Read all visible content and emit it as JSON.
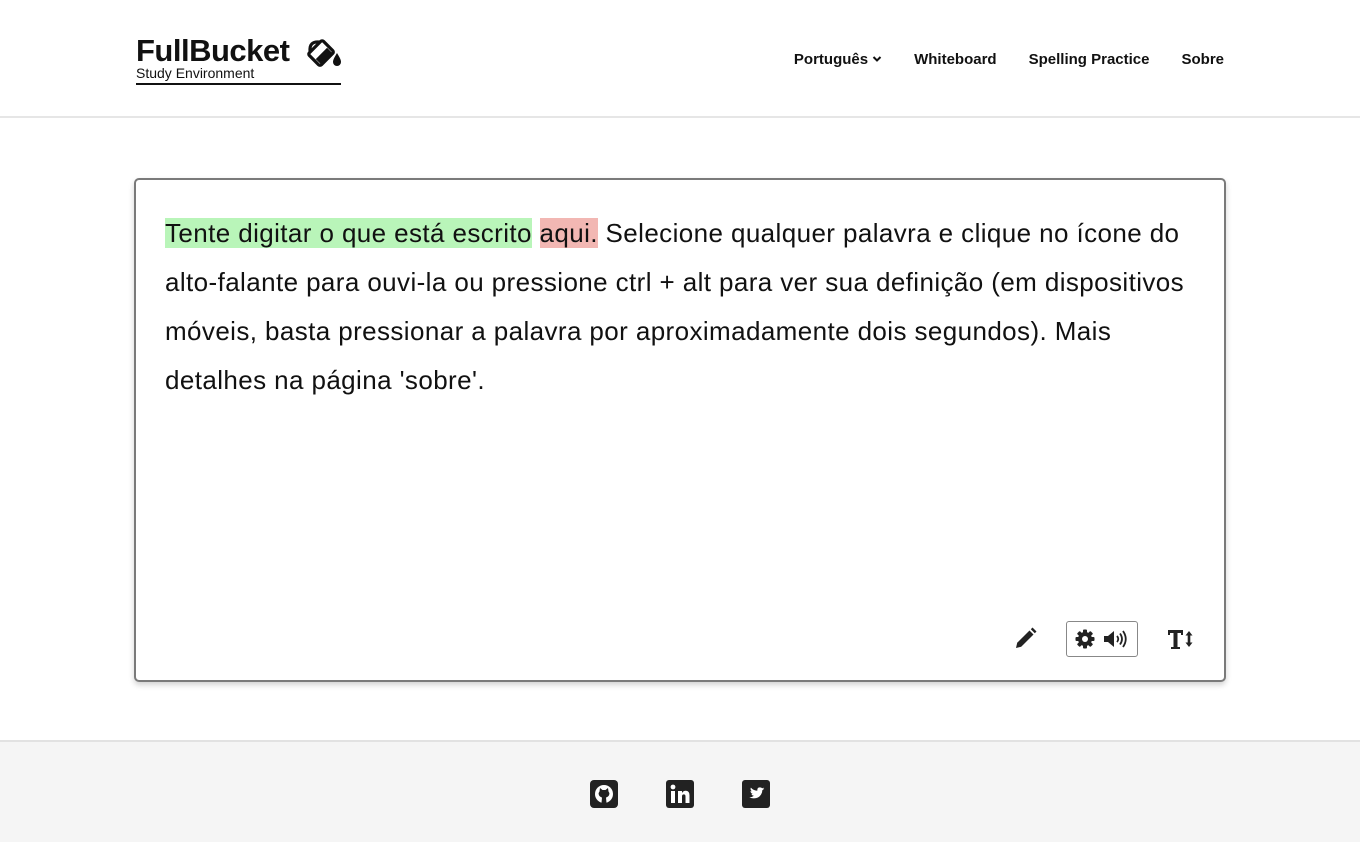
{
  "header": {
    "brand_name": "FullBucket",
    "brand_sub": "Study Environment",
    "brand_icon": "paint-bucket-icon",
    "nav": {
      "language": "Português",
      "whiteboard": "Whiteboard",
      "spelling": "Spelling Practice",
      "about": "Sobre"
    }
  },
  "editor": {
    "typed_correct": "Tente digitar o que está escrito",
    "typed_wrong": "aqui.",
    "rest_text": "Selecione qualquer palavra e clique no ícone do alto-falante para ouvi-la ou pressione ctrl + alt para ver sua definição (em dispositivos móveis, basta pressionar a palavra por aproximadamente dois segundos). Mais detalhes na página 'sobre'.",
    "highlight_colors": {
      "correct": "#b9f5b9",
      "wrong": "#f2b7b3"
    },
    "toolbar_icons": [
      "pencil-icon",
      "gear-icon",
      "speaker-icon",
      "text-size-icon"
    ]
  },
  "footer": {
    "social_icons": [
      "github-icon",
      "linkedin-icon",
      "twitter-icon"
    ]
  }
}
